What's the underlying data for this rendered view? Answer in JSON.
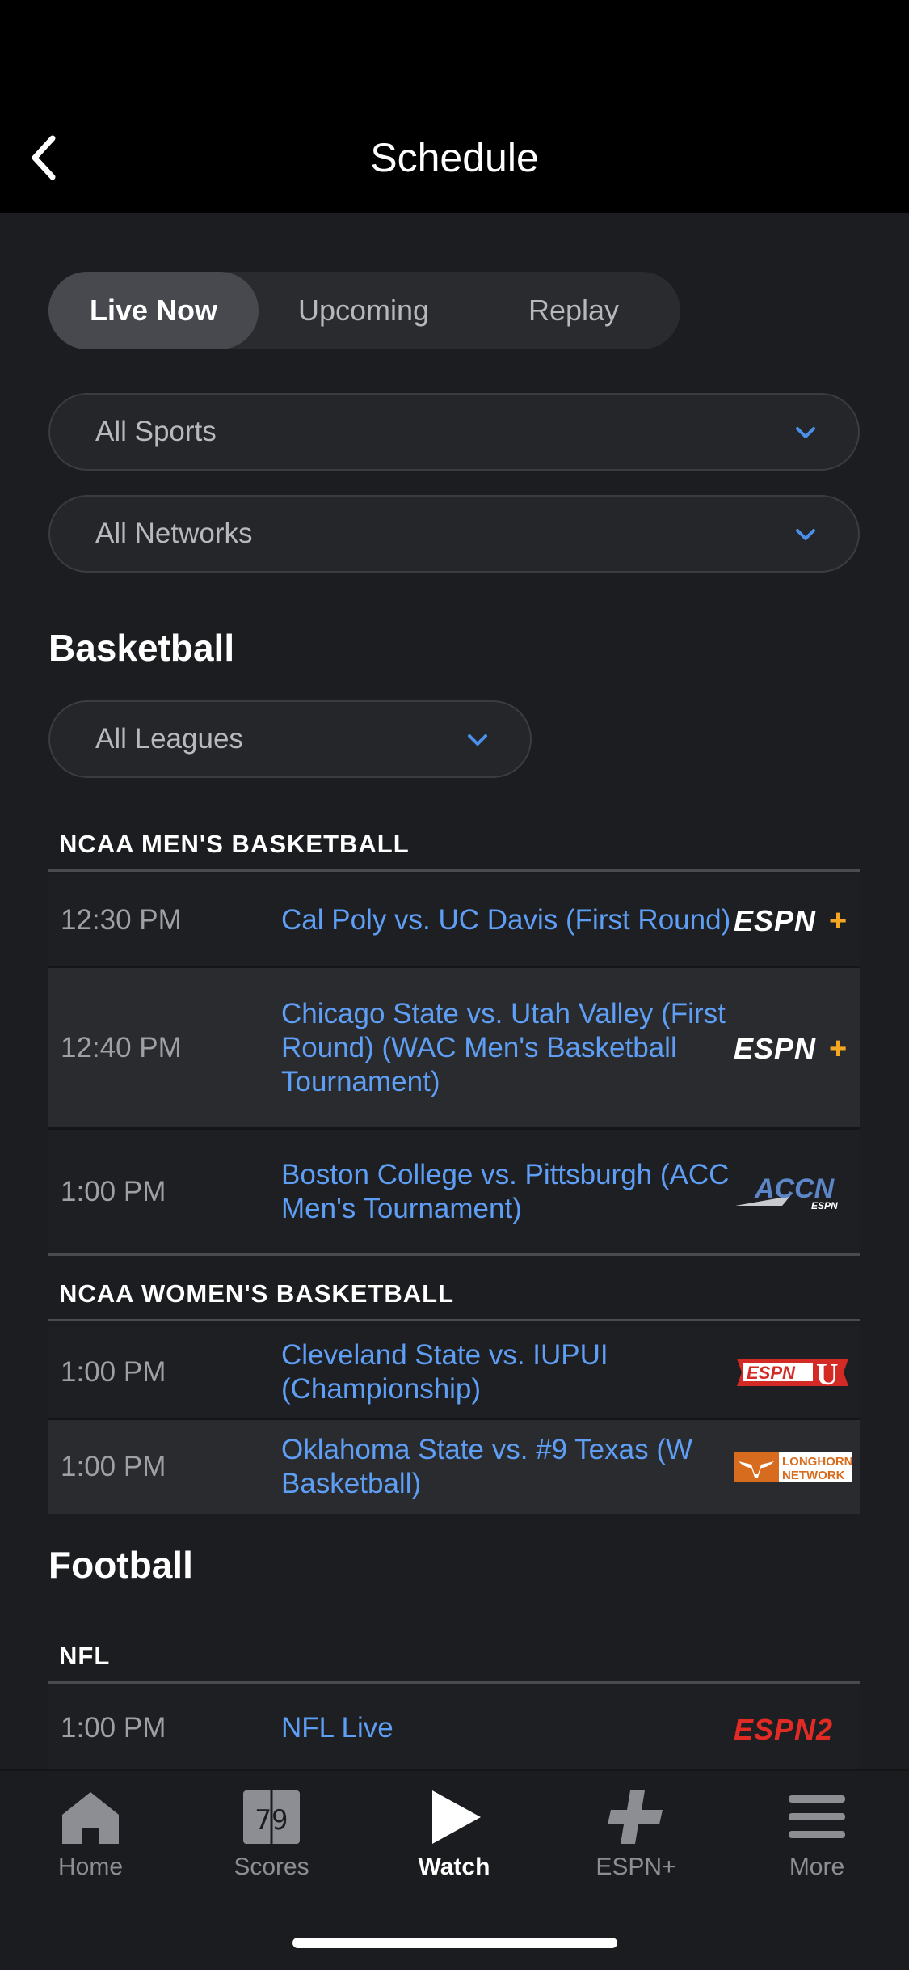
{
  "header": {
    "title": "Schedule"
  },
  "tabs": [
    {
      "label": "Live Now",
      "active": true
    },
    {
      "label": "Upcoming",
      "active": false
    },
    {
      "label": "Replay",
      "active": false
    }
  ],
  "filters": {
    "sports": "All Sports",
    "networks": "All Networks"
  },
  "sections": {
    "basketball": {
      "title": "Basketball",
      "league_filter": "All Leagues",
      "ncaa_men": {
        "header": "NCAA MEN'S BASKETBALL",
        "rows": [
          {
            "time": "12:30 PM",
            "game": "Cal Poly vs. UC Davis (First Round)",
            "network": "ESPN+"
          },
          {
            "time": "12:40 PM",
            "game": "Chicago State vs. Utah Valley (First Round) (WAC Men's Basketball Tournament)",
            "network": "ESPN+"
          },
          {
            "time": "1:00 PM",
            "game": "Boston College vs. Pittsburgh (ACC Men's Tournament)",
            "network": "ACCN"
          }
        ]
      },
      "ncaa_women": {
        "header": "NCAA WOMEN'S BASKETBALL",
        "rows": [
          {
            "time": "1:00 PM",
            "game": "Cleveland State vs. IUPUI (Championship)",
            "network": "ESPNU"
          },
          {
            "time": "1:00 PM",
            "game": "Oklahoma State vs. #9 Texas (W Basketball)",
            "network": "LONGHORN NETWORK"
          }
        ]
      }
    },
    "football": {
      "title": "Football",
      "nfl": {
        "header": "NFL",
        "rows": [
          {
            "time": "1:00 PM",
            "game": "NFL Live",
            "network": "ESPN2"
          }
        ]
      }
    }
  },
  "logos": {
    "espn_plus": {
      "text": "ESPN",
      "plus": "+"
    },
    "accn": {
      "text": "ACCN",
      "sub": "ESPN"
    },
    "espnu": {
      "text": "ESPN",
      "u": "U"
    },
    "lhn": {
      "line1": "LONGHORN",
      "line2": "NETWORK"
    },
    "espn2": {
      "text": "ESPN2"
    }
  },
  "tabbar": {
    "home": "Home",
    "scores": "Scores",
    "scores_icon_text": "79",
    "watch": "Watch",
    "espnplus": "ESPN+",
    "more": "More"
  },
  "colors": {
    "link": "#5e9ef5",
    "espn_red": "#e32b26",
    "plus_orange": "#f5a623",
    "lhn_orange": "#d76b1e"
  }
}
